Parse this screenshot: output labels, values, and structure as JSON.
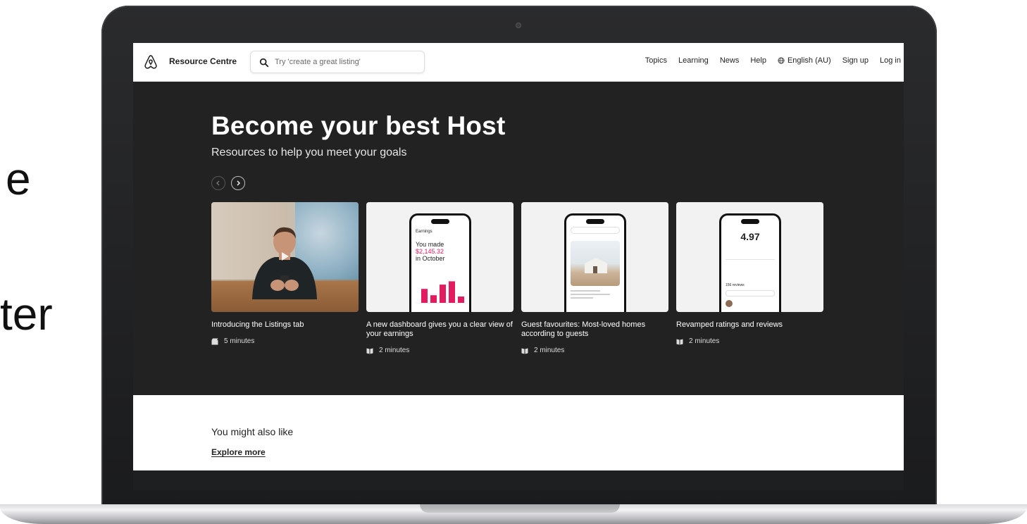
{
  "background_text": {
    "line1": "e",
    "line2": "ter"
  },
  "nav": {
    "brand": "Resource Centre",
    "search_placeholder": "Try 'create a great listing'",
    "links": [
      "Topics",
      "Learning",
      "News",
      "Help"
    ],
    "language": "English (AU)",
    "signup": "Sign up",
    "login": "Log in"
  },
  "hero": {
    "title": "Become your best Host",
    "subtitle": "Resources to help you meet your goals",
    "cards": [
      {
        "title": "Introducing the Listings tab",
        "duration": "5 minutes",
        "icon": "video-icon"
      },
      {
        "title": "A new dashboard gives you a clear view of your earnings",
        "duration": "2 minutes",
        "icon": "article-icon",
        "phone": {
          "label": "Earnings",
          "line1": "You made",
          "amount": "$2,145.32",
          "line3": "in October",
          "bars": [
            0.55,
            0.3,
            0.72,
            0.85,
            0.25
          ]
        }
      },
      {
        "title": "Guest favourites: Most-loved homes according to guests",
        "duration": "2 minutes",
        "icon": "article-icon"
      },
      {
        "title": "Revamped ratings and reviews",
        "duration": "2 minutes",
        "icon": "article-icon",
        "phone": {
          "rating": "4.97",
          "reviews": "156 reviews"
        }
      }
    ]
  },
  "more": {
    "title": "You might also like",
    "link": "Explore more"
  },
  "colors": {
    "hero_bg": "#222222",
    "accent": "#e31c5f",
    "text_dark": "#222222"
  }
}
